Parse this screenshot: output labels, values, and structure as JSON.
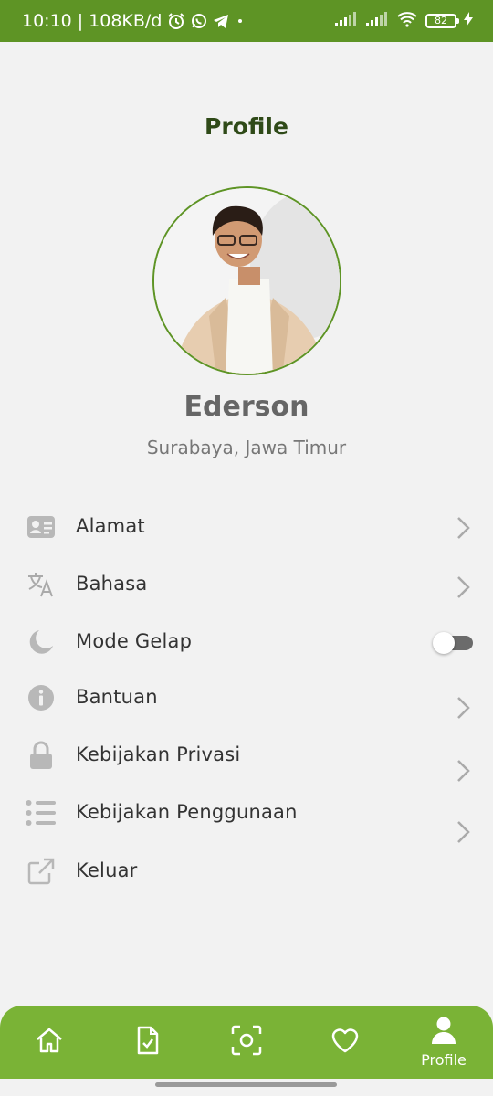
{
  "status_bar": {
    "time": "10:10",
    "speed": "108KB/d",
    "battery": "82",
    "bg_color": "#5e9425"
  },
  "header": {
    "title": "Profile"
  },
  "profile": {
    "name": "Ederson",
    "location": "Surabaya, Jawa Timur"
  },
  "menu": [
    {
      "label": "Alamat",
      "icon": "address-card-icon"
    },
    {
      "label": "Bahasa",
      "icon": "translate-icon"
    },
    {
      "label": "Mode Gelap",
      "icon": "moon-icon",
      "toggle": false
    },
    {
      "label": "Bantuan",
      "icon": "info-icon"
    },
    {
      "label": "Kebijakan Privasi",
      "icon": "lock-icon"
    },
    {
      "label": "Kebijakan Penggunaan",
      "icon": "list-icon"
    },
    {
      "label": "Keluar",
      "icon": "external-link-icon"
    }
  ],
  "bottom_nav": {
    "bg_color": "#7ab336",
    "items": [
      {
        "icon": "home-icon"
      },
      {
        "icon": "document-check-icon"
      },
      {
        "icon": "scan-icon"
      },
      {
        "icon": "heart-icon"
      },
      {
        "icon": "user-icon",
        "label": "Profile",
        "active": true
      }
    ]
  }
}
